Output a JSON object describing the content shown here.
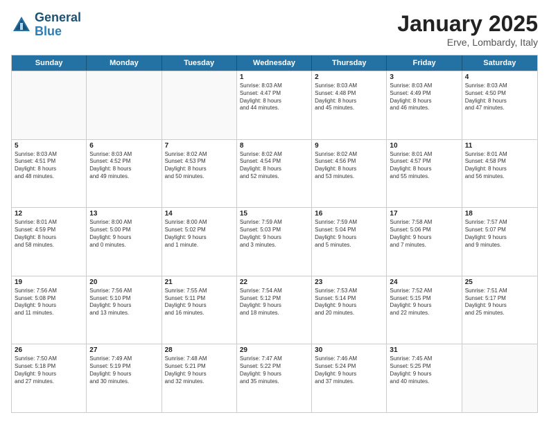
{
  "header": {
    "logo_line1": "General",
    "logo_line2": "Blue",
    "month": "January 2025",
    "location": "Erve, Lombardy, Italy"
  },
  "weekdays": [
    "Sunday",
    "Monday",
    "Tuesday",
    "Wednesday",
    "Thursday",
    "Friday",
    "Saturday"
  ],
  "rows": [
    [
      {
        "day": "",
        "content": "",
        "empty": true
      },
      {
        "day": "",
        "content": "",
        "empty": true
      },
      {
        "day": "",
        "content": "",
        "empty": true
      },
      {
        "day": "1",
        "content": "Sunrise: 8:03 AM\nSunset: 4:47 PM\nDaylight: 8 hours\nand 44 minutes."
      },
      {
        "day": "2",
        "content": "Sunrise: 8:03 AM\nSunset: 4:48 PM\nDaylight: 8 hours\nand 45 minutes."
      },
      {
        "day": "3",
        "content": "Sunrise: 8:03 AM\nSunset: 4:49 PM\nDaylight: 8 hours\nand 46 minutes."
      },
      {
        "day": "4",
        "content": "Sunrise: 8:03 AM\nSunset: 4:50 PM\nDaylight: 8 hours\nand 47 minutes."
      }
    ],
    [
      {
        "day": "5",
        "content": "Sunrise: 8:03 AM\nSunset: 4:51 PM\nDaylight: 8 hours\nand 48 minutes."
      },
      {
        "day": "6",
        "content": "Sunrise: 8:03 AM\nSunset: 4:52 PM\nDaylight: 8 hours\nand 49 minutes."
      },
      {
        "day": "7",
        "content": "Sunrise: 8:02 AM\nSunset: 4:53 PM\nDaylight: 8 hours\nand 50 minutes."
      },
      {
        "day": "8",
        "content": "Sunrise: 8:02 AM\nSunset: 4:54 PM\nDaylight: 8 hours\nand 52 minutes."
      },
      {
        "day": "9",
        "content": "Sunrise: 8:02 AM\nSunset: 4:56 PM\nDaylight: 8 hours\nand 53 minutes."
      },
      {
        "day": "10",
        "content": "Sunrise: 8:01 AM\nSunset: 4:57 PM\nDaylight: 8 hours\nand 55 minutes."
      },
      {
        "day": "11",
        "content": "Sunrise: 8:01 AM\nSunset: 4:58 PM\nDaylight: 8 hours\nand 56 minutes."
      }
    ],
    [
      {
        "day": "12",
        "content": "Sunrise: 8:01 AM\nSunset: 4:59 PM\nDaylight: 8 hours\nand 58 minutes."
      },
      {
        "day": "13",
        "content": "Sunrise: 8:00 AM\nSunset: 5:00 PM\nDaylight: 9 hours\nand 0 minutes."
      },
      {
        "day": "14",
        "content": "Sunrise: 8:00 AM\nSunset: 5:02 PM\nDaylight: 9 hours\nand 1 minute."
      },
      {
        "day": "15",
        "content": "Sunrise: 7:59 AM\nSunset: 5:03 PM\nDaylight: 9 hours\nand 3 minutes."
      },
      {
        "day": "16",
        "content": "Sunrise: 7:59 AM\nSunset: 5:04 PM\nDaylight: 9 hours\nand 5 minutes."
      },
      {
        "day": "17",
        "content": "Sunrise: 7:58 AM\nSunset: 5:06 PM\nDaylight: 9 hours\nand 7 minutes."
      },
      {
        "day": "18",
        "content": "Sunrise: 7:57 AM\nSunset: 5:07 PM\nDaylight: 9 hours\nand 9 minutes."
      }
    ],
    [
      {
        "day": "19",
        "content": "Sunrise: 7:56 AM\nSunset: 5:08 PM\nDaylight: 9 hours\nand 11 minutes."
      },
      {
        "day": "20",
        "content": "Sunrise: 7:56 AM\nSunset: 5:10 PM\nDaylight: 9 hours\nand 13 minutes."
      },
      {
        "day": "21",
        "content": "Sunrise: 7:55 AM\nSunset: 5:11 PM\nDaylight: 9 hours\nand 16 minutes."
      },
      {
        "day": "22",
        "content": "Sunrise: 7:54 AM\nSunset: 5:12 PM\nDaylight: 9 hours\nand 18 minutes."
      },
      {
        "day": "23",
        "content": "Sunrise: 7:53 AM\nSunset: 5:14 PM\nDaylight: 9 hours\nand 20 minutes."
      },
      {
        "day": "24",
        "content": "Sunrise: 7:52 AM\nSunset: 5:15 PM\nDaylight: 9 hours\nand 22 minutes."
      },
      {
        "day": "25",
        "content": "Sunrise: 7:51 AM\nSunset: 5:17 PM\nDaylight: 9 hours\nand 25 minutes."
      }
    ],
    [
      {
        "day": "26",
        "content": "Sunrise: 7:50 AM\nSunset: 5:18 PM\nDaylight: 9 hours\nand 27 minutes."
      },
      {
        "day": "27",
        "content": "Sunrise: 7:49 AM\nSunset: 5:19 PM\nDaylight: 9 hours\nand 30 minutes."
      },
      {
        "day": "28",
        "content": "Sunrise: 7:48 AM\nSunset: 5:21 PM\nDaylight: 9 hours\nand 32 minutes."
      },
      {
        "day": "29",
        "content": "Sunrise: 7:47 AM\nSunset: 5:22 PM\nDaylight: 9 hours\nand 35 minutes."
      },
      {
        "day": "30",
        "content": "Sunrise: 7:46 AM\nSunset: 5:24 PM\nDaylight: 9 hours\nand 37 minutes."
      },
      {
        "day": "31",
        "content": "Sunrise: 7:45 AM\nSunset: 5:25 PM\nDaylight: 9 hours\nand 40 minutes."
      },
      {
        "day": "",
        "content": "",
        "empty": true
      }
    ]
  ]
}
